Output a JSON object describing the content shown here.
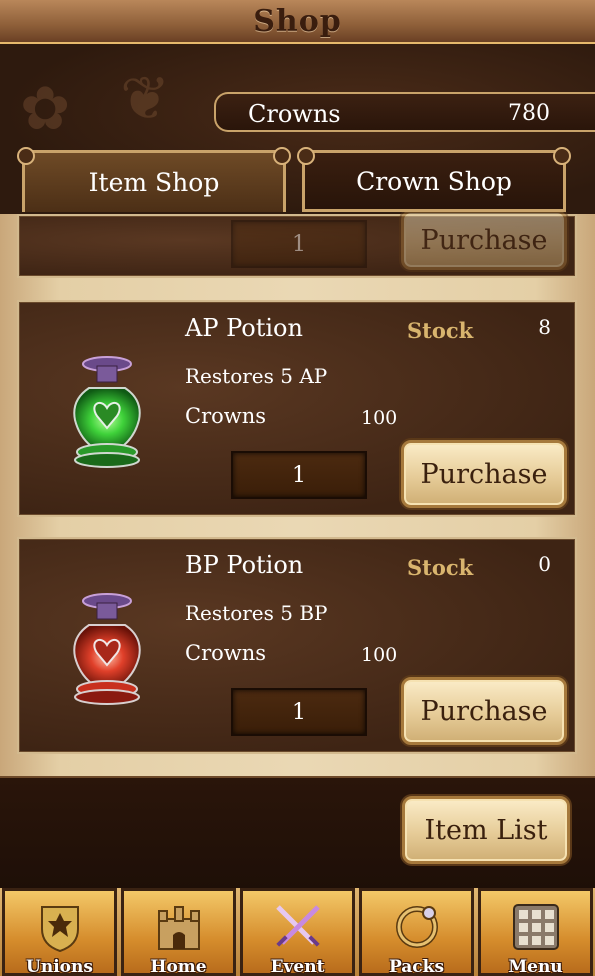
{
  "title": "Shop",
  "currency": {
    "label": "Crowns",
    "value": "780"
  },
  "tabs": [
    {
      "label": "Item Shop",
      "active": true
    },
    {
      "label": "Crown Shop",
      "active": false
    }
  ],
  "partial_item": {
    "quantity": "1",
    "purchase_label": "Purchase"
  },
  "items": [
    {
      "name": "AP Potion",
      "stock_label": "Stock",
      "stock": "8",
      "description": "Restores 5 AP",
      "price_label": "Crowns",
      "price": "100",
      "quantity": "1",
      "purchase_label": "Purchase",
      "color": "#3fd23a"
    },
    {
      "name": "BP Potion",
      "stock_label": "Stock",
      "stock": "0",
      "description": "Restores 5 BP",
      "price_label": "Crowns",
      "price": "100",
      "quantity": "1",
      "purchase_label": "Purchase",
      "color": "#e0402a"
    }
  ],
  "item_list_label": "Item List",
  "nav": [
    {
      "label": "Unions",
      "icon": "crest-icon"
    },
    {
      "label": "Home",
      "icon": "castle-icon"
    },
    {
      "label": "Event",
      "icon": "crossed-swords-icon"
    },
    {
      "label": "Packs",
      "icon": "ring-icon"
    },
    {
      "label": "Menu",
      "icon": "grid-icon"
    }
  ],
  "colors": {
    "accent_gold": "#c9a36a",
    "stock_gold": "#d9b56e",
    "parchment": "#ead8b4",
    "panel": "#4a2c18"
  }
}
